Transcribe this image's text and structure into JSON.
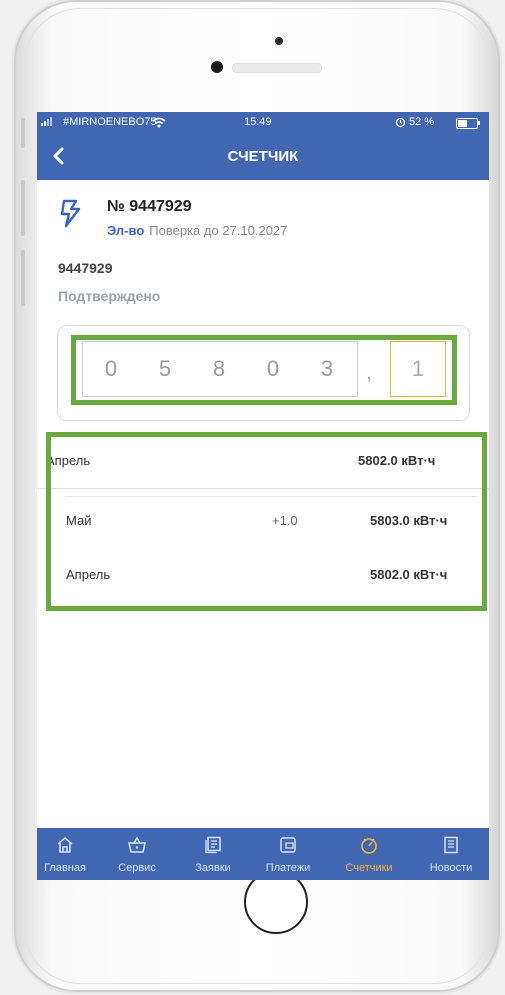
{
  "status_bar": {
    "carrier": "#MIRNOENEBO75",
    "time": "15:49",
    "battery": "52 %"
  },
  "header": {
    "title": "СЧЕТЧИК"
  },
  "meter": {
    "number": "№ 9447929",
    "type": "Эл-во",
    "verification": "Поверка до 27.10.2027",
    "account": "9447929",
    "status": "Подтверждено"
  },
  "reading": {
    "digits": [
      "0",
      "5",
      "8",
      "0",
      "3"
    ],
    "separator": ",",
    "decimal": "1"
  },
  "current": {
    "month": "Апрель",
    "value": "5802.0 кВт·ч"
  },
  "history": [
    {
      "month": "Май",
      "delta": "+1.0",
      "value": "5803.0 кВт·ч"
    },
    {
      "month": "Апрель",
      "delta": "",
      "value": "5802.0 кВт·ч"
    }
  ],
  "tabs": [
    {
      "label": "Главная",
      "icon": "home-icon"
    },
    {
      "label": "Сервис",
      "icon": "basket-icon"
    },
    {
      "label": "Заявки",
      "icon": "requests-icon"
    },
    {
      "label": "Платежи",
      "icon": "wallet-icon"
    },
    {
      "label": "Счетчики",
      "icon": "gauge-icon"
    },
    {
      "label": "Новости",
      "icon": "news-icon"
    }
  ],
  "active_tab": "Счетчики",
  "colors": {
    "primary": "#4267b2",
    "accent": "#f2b43c",
    "highlight": "#6aa840"
  }
}
